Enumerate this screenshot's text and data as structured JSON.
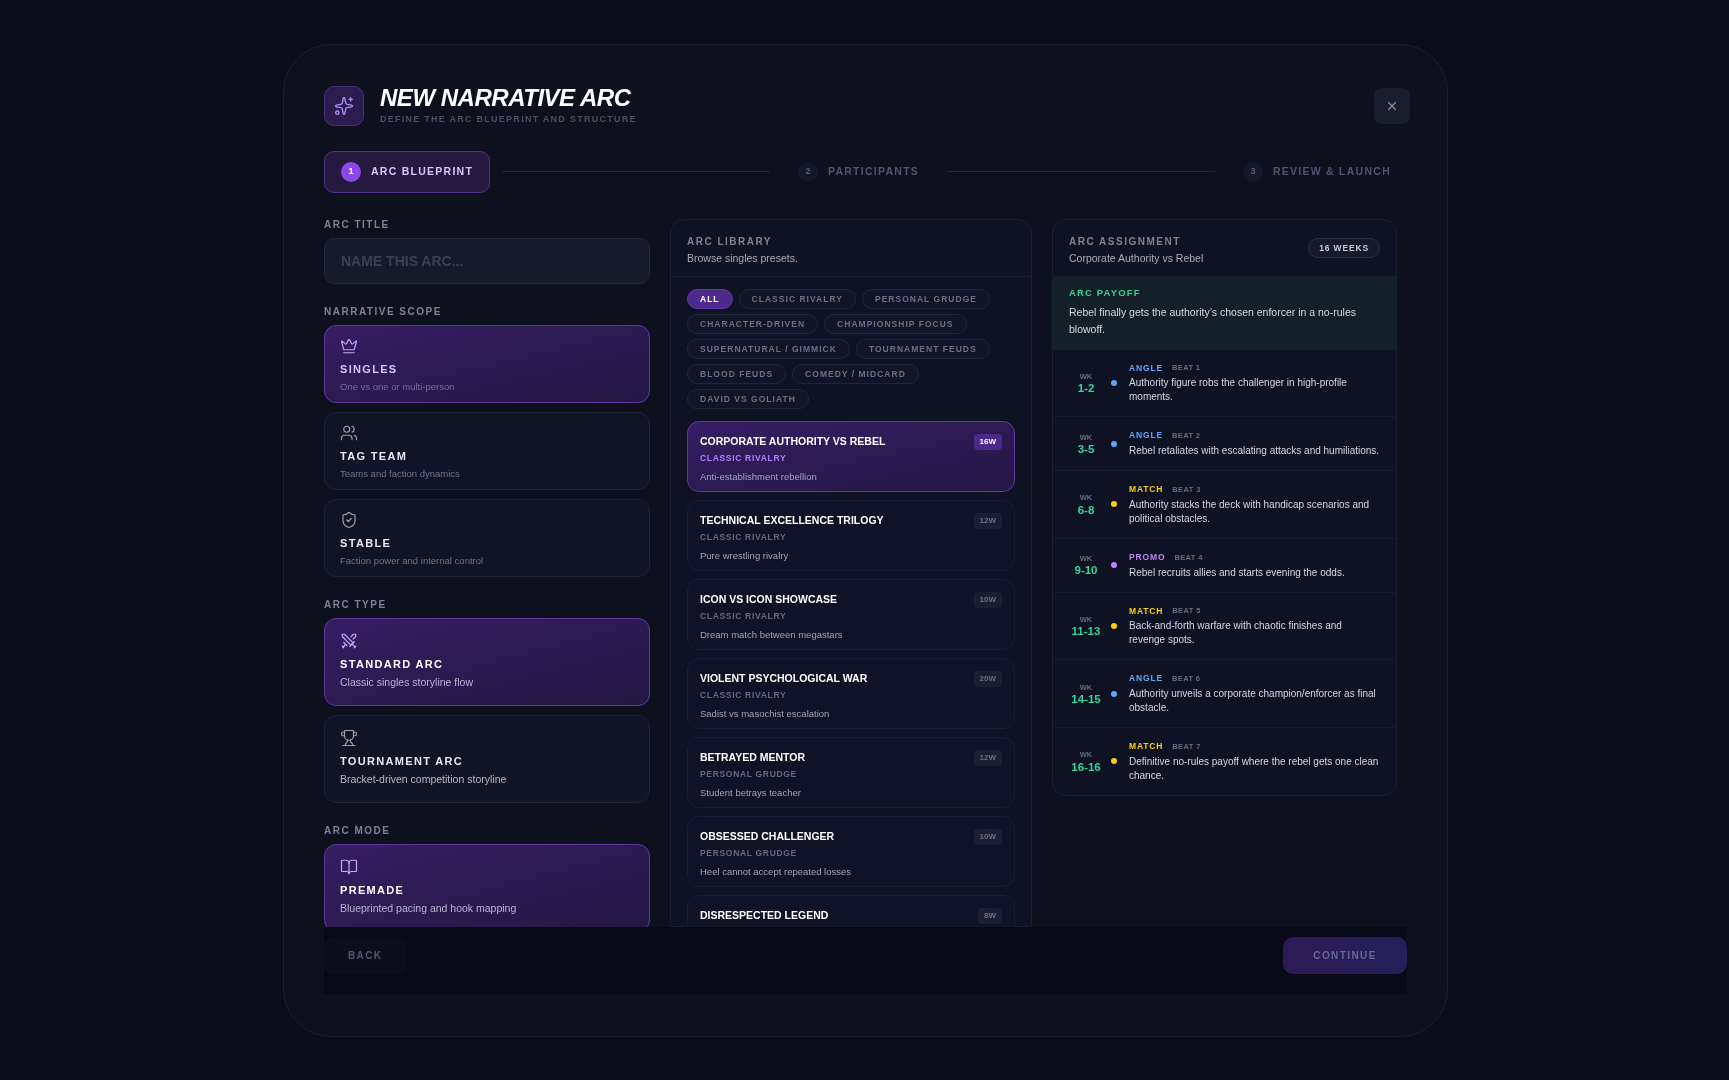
{
  "header": {
    "title": "NEW NARRATIVE ARC",
    "subtitle": "DEFINE THE ARC BLUEPRINT AND STRUCTURE"
  },
  "steps": [
    {
      "number": "1",
      "label": "ARC BLUEPRINT",
      "selected": true
    },
    {
      "number": "2",
      "label": "PARTICIPANTS",
      "selected": false
    },
    {
      "number": "3",
      "label": "REVIEW & LAUNCH",
      "selected": false
    }
  ],
  "arc_title": {
    "label": "ARC TITLE",
    "placeholder": "NAME THIS ARC..."
  },
  "option_groups": [
    {
      "label": "NARRATIVE SCOPE",
      "options": [
        {
          "title": "SINGLES",
          "description": "One vs one or multi-person",
          "selected": true
        },
        {
          "title": "TAG TEAM",
          "description": "Teams and faction dynamics",
          "selected": false
        },
        {
          "title": "STABLE",
          "description": "Faction power and internal control",
          "selected": false
        }
      ]
    },
    {
      "label": "ARC TYPE",
      "options": [
        {
          "title": "STANDARD ARC",
          "description": "Classic singles storyline flow",
          "selected": true
        },
        {
          "title": "TOURNAMENT ARC",
          "description": "Bracket-driven competition storyline",
          "selected": false
        }
      ]
    },
    {
      "label": "ARC MODE",
      "options": [
        {
          "title": "PREMADE",
          "description": "Blueprinted pacing and hook mapping",
          "selected": true
        }
      ]
    }
  ],
  "library": {
    "label": "ARC LIBRARY",
    "subtitle": "Browse singles presets.",
    "filters": [
      {
        "label": "ALL",
        "selected": true
      },
      {
        "label": "CLASSIC RIVALRY",
        "selected": false
      },
      {
        "label": "PERSONAL GRUDGE",
        "selected": false
      },
      {
        "label": "CHARACTER-DRIVEN",
        "selected": false
      },
      {
        "label": "CHAMPIONSHIP FOCUS",
        "selected": false
      },
      {
        "label": "SUPERNATURAL / GIMMICK",
        "selected": false
      },
      {
        "label": "TOURNAMENT FEUDS",
        "selected": false
      },
      {
        "label": "BLOOD FEUDS",
        "selected": false
      },
      {
        "label": "COMEDY / MIDCARD",
        "selected": false
      },
      {
        "label": "DAVID VS GOLIATH",
        "selected": false
      }
    ],
    "presets": [
      {
        "title": "CORPORATE AUTHORITY VS REBEL",
        "category": "CLASSIC RIVALRY",
        "description": "Anti-establishment rebellion",
        "weeks": "16W",
        "selected": true
      },
      {
        "title": "TECHNICAL EXCELLENCE TRILOGY",
        "category": "CLASSIC RIVALRY",
        "description": "Pure wrestling rivalry",
        "weeks": "12W",
        "selected": false
      },
      {
        "title": "ICON VS ICON SHOWCASE",
        "category": "CLASSIC RIVALRY",
        "description": "Dream match between megastars",
        "weeks": "10W",
        "selected": false
      },
      {
        "title": "VIOLENT PSYCHOLOGICAL WAR",
        "category": "CLASSIC RIVALRY",
        "description": "Sadist vs masochist escalation",
        "weeks": "20W",
        "selected": false
      },
      {
        "title": "BETRAYED MENTOR",
        "category": "PERSONAL GRUDGE",
        "description": "Student betrays teacher",
        "weeks": "12W",
        "selected": false
      },
      {
        "title": "OBSESSED CHALLENGER",
        "category": "PERSONAL GRUDGE",
        "description": "Heel cannot accept repeated losses",
        "weeks": "10W",
        "selected": false
      },
      {
        "title": "DISRESPECTED LEGEND",
        "weeks": "8W",
        "selected": false
      }
    ]
  },
  "assignment": {
    "label": "ARC ASSIGNMENT",
    "subtitle": "Corporate Authority vs Rebel",
    "duration": "16 WEEKS",
    "payoff": {
      "label": "ARC PAYOFF",
      "text": "Rebel finally gets the authority’s chosen enforcer in a no-rules blowoff."
    },
    "beats": [
      {
        "wk": "WK",
        "weeks": "1-2",
        "type": "ANGLE",
        "beat": "BEAT 1",
        "text": "Authority figure robs the challenger in high-profile moments.",
        "color": "#60a5fa"
      },
      {
        "wk": "WK",
        "weeks": "3-5",
        "type": "ANGLE",
        "beat": "BEAT 2",
        "text": "Rebel retaliates with escalating attacks and humiliations.",
        "color": "#60a5fa"
      },
      {
        "wk": "WK",
        "weeks": "6-8",
        "type": "MATCH",
        "beat": "BEAT 3",
        "text": "Authority stacks the deck with handicap scenarios and political obstacles.",
        "color": "#facc15"
      },
      {
        "wk": "WK",
        "weeks": "9-10",
        "type": "PROMO",
        "beat": "BEAT 4",
        "text": "Rebel recruits allies and starts evening the odds.",
        "color": "#c084fc"
      },
      {
        "wk": "WK",
        "weeks": "11-13",
        "type": "MATCH",
        "beat": "BEAT 5",
        "text": "Back-and-forth warfare with chaotic finishes and revenge spots.",
        "color": "#facc15"
      },
      {
        "wk": "WK",
        "weeks": "14-15",
        "type": "ANGLE",
        "beat": "BEAT 6",
        "text": "Authority unveils a corporate champion/enforcer as final obstacle.",
        "color": "#60a5fa"
      },
      {
        "wk": "WK",
        "weeks": "16-16",
        "type": "MATCH",
        "beat": "BEAT 7",
        "text": "Definitive no-rules payoff where the rebel gets one clean chance.",
        "color": "#facc15"
      }
    ]
  },
  "footer": {
    "back": {
      "label": "BACK",
      "disabled": true
    },
    "continue": {
      "label": "CONTINUE",
      "disabled": true
    }
  }
}
